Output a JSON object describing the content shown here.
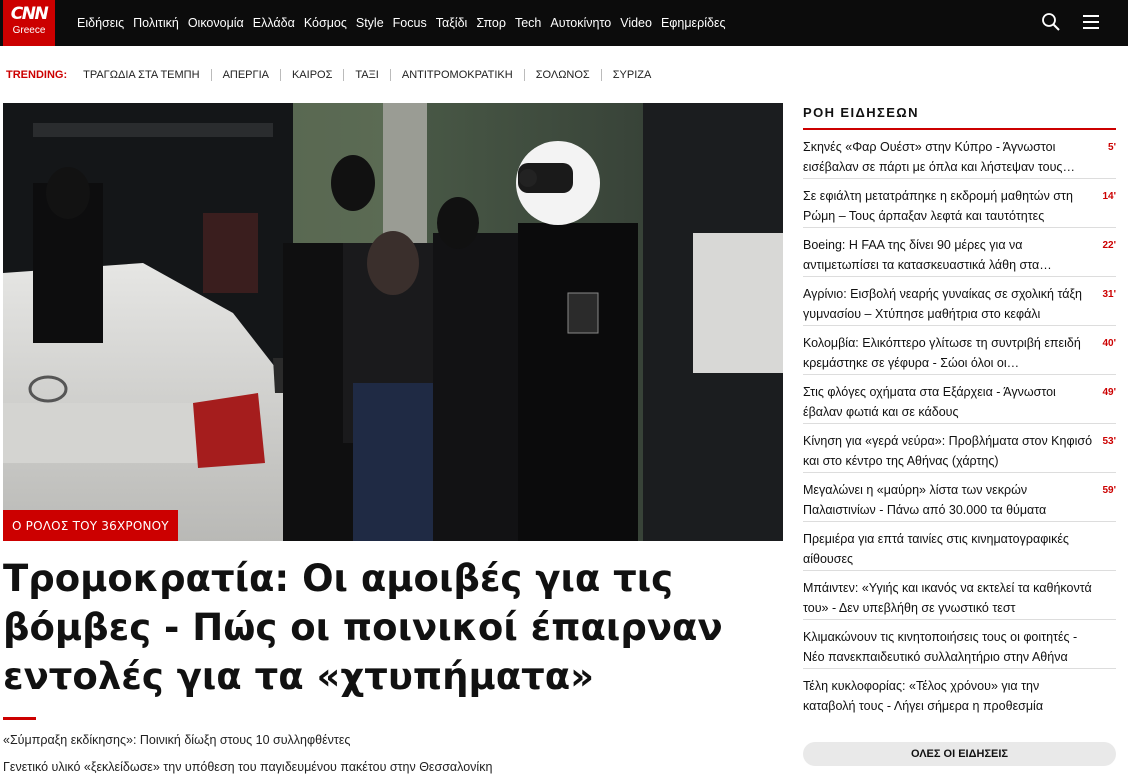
{
  "header": {
    "logo_top": "CNN",
    "logo_bottom": "Greece",
    "nav": [
      "Ειδήσεις",
      "Πολιτική",
      "Οικονομία",
      "Ελλάδα",
      "Κόσμος",
      "Style",
      "Focus",
      "Ταξίδι",
      "Σπορ",
      "Tech",
      "Αυτοκίνητο",
      "Video",
      "Εφημερίδες"
    ],
    "icons": [
      "search-icon",
      "menu-icon"
    ]
  },
  "trending": {
    "label": "TRENDING:",
    "items": [
      "ΤΡΑΓΩΔΙΑ ΣΤΑ ΤΕΜΠΗ",
      "ΑΠΕΡΓΙΑ",
      "ΚΑΙΡΟΣ",
      "ΤΑΞΙ",
      "ΑΝΤΙΤΡΟΜΟΚΡΑΤΙΚΗ",
      "ΣΟΛΩΝΟΣ",
      "ΣΥΡΙΖΑ"
    ]
  },
  "main": {
    "tag": "Ο ΡΟΛΟΣ ΤΟΥ 36ΧΡΟΝΟΥ",
    "headline": "Τρομοκρατία: Οι αμοιβές για τις βόμβες - Πώς οι ποινικοί έπαιρναν εντολές για τα «χτυπήματα»",
    "related": [
      "«Σύμπραξη εκδίκησης»: Ποινική δίωξη στους 10 συλληφθέντες",
      "Γενετικό υλικό «ξεκλείδωσε» την υπόθεση του παγιδευμένου πακέτου στην Θεσσαλονίκη"
    ]
  },
  "feed": {
    "title": "ΡΟΗ ΕΙΔΗΣΕΩΝ",
    "items": [
      {
        "text": "Σκηνές «Φαρ Ουέστ» στην Κύπρο - Άγνωστοι εισέβαλαν σε πάρτι με όπλα και λήστεψαν τους…",
        "time": "5'"
      },
      {
        "text": "Σε εφιάλτη μετατράπηκε η εκδρομή μαθητών στη Ρώμη – Τους άρπαξαν λεφτά και ταυτότητες",
        "time": "14'"
      },
      {
        "text": "Boeing: Η FAA της δίνει 90 μέρες για να αντιμετωπίσει τα κατασκευαστικά λάθη στα…",
        "time": "22'"
      },
      {
        "text": "Αγρίνιο: Εισβολή νεαρής γυναίκας σε σχολική τάξη γυμνασίου – Χτύπησε μαθήτρια στο κεφάλι",
        "time": "31'"
      },
      {
        "text": "Κολομβία: Ελικόπτερο γλίτωσε τη συντριβή επειδή κρεμάστηκε σε γέφυρα - Σώοι όλοι οι…",
        "time": "40'"
      },
      {
        "text": "Στις φλόγες οχήματα στα Εξάρχεια - Άγνωστοι έβαλαν φωτιά και σε κάδους",
        "time": "49'"
      },
      {
        "text": "Κίνηση για «γερά νεύρα»: Προβλήματα στον Κηφισό και στο κέντρο της Αθήνας (χάρτης)",
        "time": "53'"
      },
      {
        "text": "Μεγαλώνει η «μαύρη» λίστα των νεκρών Παλαιστινίων - Πάνω από 30.000 τα θύματα",
        "time": "59'"
      },
      {
        "text": "Πρεμιέρα για επτά ταινίες στις κινηματογραφικές αίθουσες",
        "time": ""
      },
      {
        "text": "Μπάιντεν: «Υγιής και ικανός να εκτελεί τα καθήκοντά του» - Δεν υπεβλήθη σε γνωστικό τεστ",
        "time": ""
      },
      {
        "text": "Κλιμακώνουν τις κινητοποιήσεις τους οι φοιτητές - Νέο πανεκπαιδευτικό συλλαλητήριο στην Αθήνα",
        "time": ""
      },
      {
        "text": "Τέλη κυκλοφορίας: «Τέλος χρόνου» για την καταβολή τους - Λήγει σήμερα η προθεσμία",
        "time": ""
      }
    ],
    "all_button": "ΟΛΕΣ ΟΙ ΕΙΔΗΣΕΙΣ"
  },
  "colors": {
    "brand_red": "#cc0000",
    "topbar": "#0c0c0c",
    "button_bg": "#e9e9e9"
  }
}
